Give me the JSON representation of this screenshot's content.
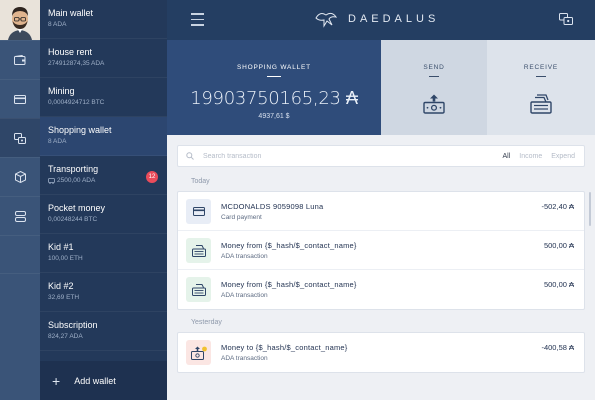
{
  "app": {
    "brand": "DAEDALUS"
  },
  "sidebar": {
    "icons": [
      "wallet-icon",
      "card-icon",
      "exchange-icon",
      "cube-icon",
      "server-icon"
    ],
    "active_icon": 2
  },
  "wallets": [
    {
      "name": "Main wallet",
      "balance": "8 ADA",
      "active": false
    },
    {
      "name": "House rent",
      "balance": "274912874,35 ADA",
      "active": false
    },
    {
      "name": "Mining",
      "balance": "0,0004924712 BTC",
      "active": false
    },
    {
      "name": "Shopping wallet",
      "balance": "8 ADA",
      "active": true
    },
    {
      "name": "Transporting",
      "balance": "2500,00 ADA",
      "badge": "12",
      "active": false
    },
    {
      "name": "Pocket money",
      "balance": "0,00248244 BTC",
      "active": false
    },
    {
      "name": "Kid #1",
      "balance": "100,00 ETH",
      "active": false
    },
    {
      "name": "Kid #2",
      "balance": "32,69 ETH",
      "active": false
    },
    {
      "name": "Subscription",
      "balance": "824,27 ADA",
      "active": false
    }
  ],
  "add_wallet_label": "Add wallet",
  "wallet_nav": {
    "summary_label": "SHOPPING WALLET",
    "amount": "19903750165,23 ₳",
    "amount_usd": "4937,61 $",
    "send_label": "SEND",
    "receive_label": "RECEIVE"
  },
  "search": {
    "placeholder": "Search transaction",
    "filters": [
      "All",
      "Income",
      "Expend"
    ],
    "active_filter": "All"
  },
  "groups": [
    {
      "label": "Today",
      "transactions": [
        {
          "title": "MCDONALDS 9059098 Luna",
          "type": "Card payment",
          "amount": "-502,40 ₳",
          "icon": "card-icon",
          "icon_bg": "#e8edf6"
        },
        {
          "title": "Money from {$_hash/$_contact_name}",
          "type": "ADA transaction",
          "amount": "500,00 ₳",
          "icon": "money-in-icon",
          "icon_bg": "#e5f3ea"
        },
        {
          "title": "Money from {$_hash/$_contact_name}",
          "type": "ADA transaction",
          "amount": "500,00 ₳",
          "icon": "money-in-icon",
          "icon_bg": "#e5f3ea"
        }
      ]
    },
    {
      "label": "Yesterday",
      "transactions": [
        {
          "title": "Money to {$_hash/$_contact_name}",
          "type": "ADA transaction",
          "amount": "-400,58 ₳",
          "icon": "money-out-icon",
          "icon_bg": "#fbe6e3"
        }
      ]
    }
  ],
  "colors": {
    "accent": "#2f4c7a",
    "sidebar": "#23395a",
    "rail": "#3a5478",
    "badge": "#ea4c5b"
  }
}
